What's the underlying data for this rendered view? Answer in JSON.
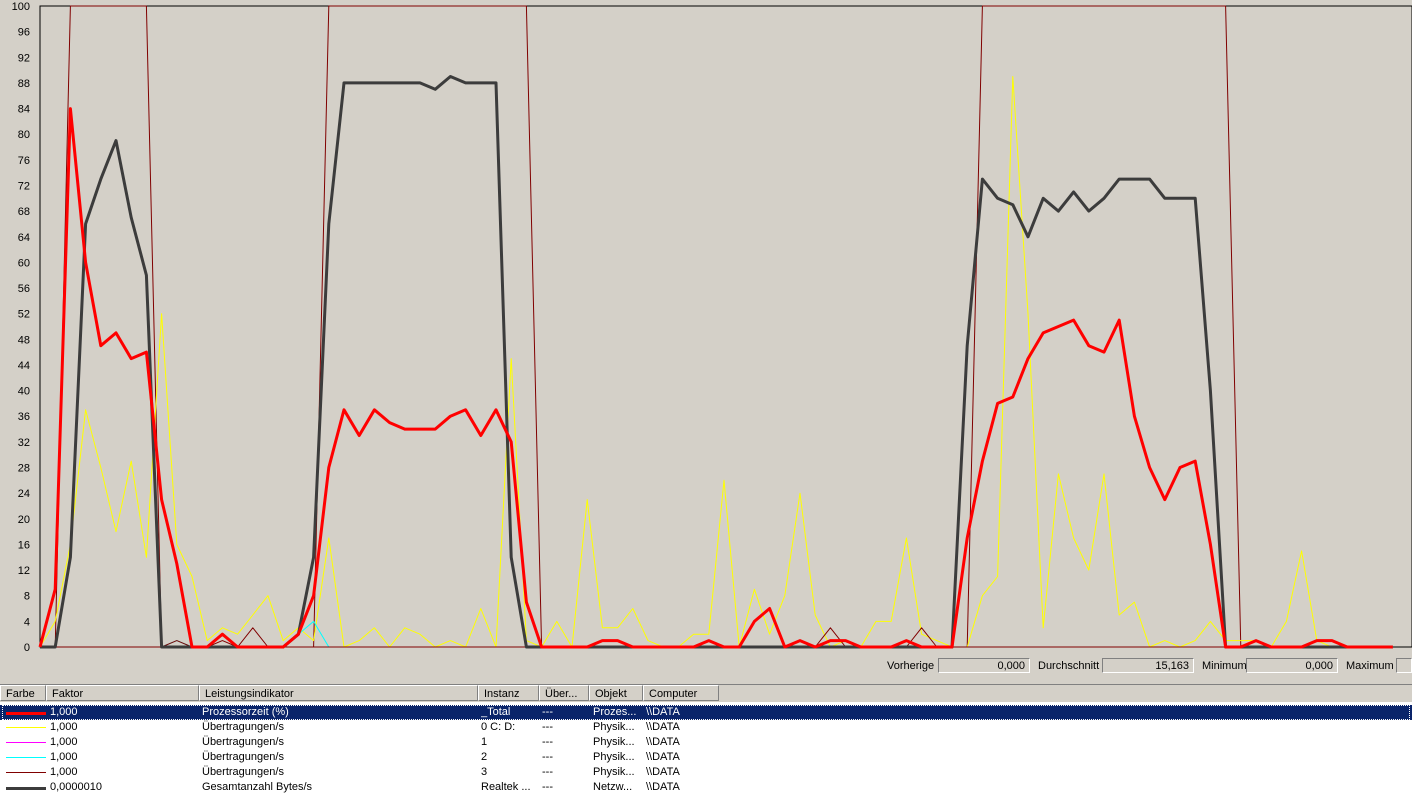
{
  "chart_data": {
    "type": "line",
    "ylim": [
      0,
      100
    ],
    "yticks": [
      0,
      4,
      8,
      12,
      16,
      20,
      24,
      28,
      32,
      36,
      40,
      44,
      48,
      52,
      56,
      60,
      64,
      68,
      72,
      76,
      80,
      84,
      88,
      92,
      96,
      100
    ],
    "grid": false,
    "x": [
      1,
      2,
      3,
      4,
      5,
      6,
      7,
      8,
      9,
      10,
      11,
      12,
      13,
      14,
      15,
      16,
      17,
      18,
      19,
      20,
      21,
      22,
      23,
      24,
      25,
      26,
      27,
      28,
      29,
      30,
      31,
      32,
      33,
      34,
      35,
      36,
      37,
      38,
      39,
      40,
      41,
      42,
      43,
      44,
      45,
      46,
      47,
      48,
      49,
      50,
      51,
      52,
      53,
      54,
      55,
      56,
      57,
      58,
      59,
      60,
      61,
      62,
      63,
      64,
      65,
      66,
      67,
      68,
      69,
      70,
      71,
      72,
      73,
      74,
      75,
      76,
      77,
      78,
      79,
      80,
      81,
      82,
      83,
      84,
      85,
      86,
      87,
      88,
      89,
      90
    ],
    "series": [
      {
        "name": "Prozessorzeit (%)",
        "color": "#ff0000",
        "width": 3,
        "values": [
          0,
          9,
          84,
          60,
          47,
          49,
          45,
          46,
          23,
          13,
          0,
          0,
          2,
          0,
          0,
          0,
          0,
          2,
          8,
          28,
          37,
          33,
          37,
          35,
          34,
          34,
          34,
          36,
          37,
          33,
          37,
          32,
          7,
          0,
          0,
          0,
          0,
          1,
          1,
          0,
          0,
          0,
          0,
          0,
          1,
          0,
          0,
          4,
          6,
          0,
          1,
          0,
          1,
          1,
          0,
          0,
          0,
          1,
          0,
          0,
          0,
          17,
          29,
          38,
          39,
          45,
          49,
          50,
          51,
          47,
          46,
          51,
          36,
          28,
          23,
          28,
          29,
          16,
          0,
          0,
          1,
          0,
          0,
          0,
          1,
          1,
          0,
          0,
          0,
          0
        ]
      },
      {
        "name": "Übertragungen/s 0 C: D:",
        "color": "#ffff00",
        "width": 1,
        "values": [
          0,
          4,
          16,
          37,
          28,
          18,
          29,
          14,
          52,
          16,
          11,
          1,
          3,
          2,
          5,
          8,
          1,
          3,
          1,
          17,
          0,
          1,
          3,
          0,
          3,
          2,
          0,
          1,
          0,
          6,
          0,
          45,
          1,
          0,
          4,
          0,
          23,
          3,
          3,
          6,
          1,
          0,
          0,
          2,
          2,
          26,
          0,
          9,
          2,
          8,
          24,
          5,
          0,
          1,
          0,
          4,
          4,
          17,
          2,
          1,
          0,
          0,
          8,
          11,
          89,
          52,
          3,
          27,
          17,
          12,
          27,
          5,
          7,
          0,
          1,
          0,
          1,
          4,
          1,
          1,
          1,
          0,
          4,
          15,
          1,
          0,
          0,
          0,
          0,
          0
        ]
      },
      {
        "name": "Übertragungen/s 1",
        "color": "#ff00ff",
        "width": 1,
        "values": [
          0,
          0,
          0,
          0,
          0,
          0,
          0,
          0,
          0,
          0,
          0,
          0,
          0,
          0,
          0,
          0,
          0,
          0,
          0,
          0,
          0,
          0,
          0,
          0,
          0,
          0,
          0,
          0,
          0,
          0,
          0,
          0,
          0,
          0,
          0,
          0,
          0,
          0,
          0,
          0,
          0,
          0,
          0,
          0,
          0,
          0,
          0,
          0,
          0,
          0,
          0,
          0,
          0,
          0,
          0,
          0,
          0,
          0,
          0,
          0,
          0,
          0,
          0,
          0,
          0,
          0,
          0,
          0,
          0,
          0,
          0,
          0,
          0,
          0,
          0,
          0,
          0,
          0,
          0,
          0,
          0,
          0,
          0,
          0,
          0,
          0,
          0,
          0,
          0,
          0
        ]
      },
      {
        "name": "Übertragungen/s 2",
        "color": "#00ffff",
        "width": 1,
        "values": [
          0,
          0,
          0,
          0,
          0,
          0,
          0,
          0,
          0,
          1,
          0,
          0,
          0,
          0,
          0,
          0,
          0,
          2,
          4,
          0,
          0,
          0,
          0,
          0,
          0,
          0,
          0,
          0,
          0,
          0,
          0,
          0,
          0,
          0,
          0,
          0,
          0,
          0,
          0,
          0,
          0,
          0,
          0,
          0,
          0,
          0,
          0,
          0,
          0,
          0,
          0,
          0,
          0,
          0,
          0,
          0,
          0,
          0,
          0,
          0,
          0,
          0,
          0,
          0,
          0,
          0,
          0,
          0,
          0,
          0,
          0,
          0,
          0,
          0,
          0,
          0,
          0,
          0,
          0,
          0,
          0,
          0,
          0,
          0,
          0,
          0,
          0,
          0,
          0,
          0
        ]
      },
      {
        "name": "Übertragungen/s 3",
        "color": "#800000",
        "width": 1,
        "values": [
          0,
          0,
          0,
          0,
          0,
          0,
          0,
          0,
          0,
          1,
          0,
          0,
          1,
          0,
          3,
          0,
          0,
          0,
          0,
          0,
          0,
          0,
          0,
          0,
          0,
          0,
          0,
          0,
          0,
          0,
          0,
          0,
          0,
          0,
          0,
          0,
          0,
          0,
          0,
          0,
          0,
          0,
          0,
          0,
          0,
          0,
          0,
          0,
          0,
          0,
          0,
          0,
          3,
          0,
          0,
          0,
          0,
          0,
          3,
          0,
          0,
          0,
          0,
          0,
          0,
          0,
          0,
          0,
          0,
          0,
          0,
          0,
          0,
          0,
          0,
          0,
          0,
          0,
          0,
          0,
          1,
          0,
          0,
          0,
          0,
          0,
          0,
          0,
          0,
          0
        ]
      },
      {
        "name": "Gesamtanzahl Bytes/s",
        "color": "#3c3c3c",
        "width": 3,
        "values": [
          0,
          0,
          14,
          66,
          73,
          79,
          67,
          58,
          0,
          0,
          0,
          0,
          0,
          0,
          0,
          0,
          0,
          2,
          14,
          66,
          88,
          88,
          88,
          88,
          88,
          88,
          87,
          89,
          88,
          88,
          88,
          14,
          0,
          0,
          0,
          0,
          0,
          0,
          0,
          0,
          0,
          0,
          0,
          0,
          0,
          0,
          0,
          0,
          0,
          0,
          0,
          0,
          0,
          0,
          0,
          0,
          0,
          0,
          0,
          0,
          0,
          47,
          73,
          70,
          69,
          64,
          70,
          68,
          71,
          68,
          70,
          73,
          73,
          73,
          70,
          70,
          70,
          40,
          0,
          0,
          0,
          0,
          0,
          0,
          0,
          0,
          0,
          0,
          0,
          0
        ]
      },
      {
        "name": "Prozessorzeit (%) Schwellwert",
        "color": "#800000",
        "width": 1,
        "values": [
          0,
          0,
          100,
          100,
          100,
          100,
          100,
          100,
          0,
          0,
          0,
          0,
          0,
          0,
          0,
          0,
          0,
          0,
          0,
          100,
          100,
          100,
          100,
          100,
          100,
          100,
          100,
          100,
          100,
          100,
          100,
          100,
          100,
          0,
          0,
          0,
          0,
          0,
          0,
          0,
          0,
          0,
          0,
          0,
          0,
          0,
          0,
          0,
          0,
          0,
          0,
          0,
          0,
          0,
          0,
          0,
          0,
          0,
          0,
          0,
          0,
          0,
          100,
          100,
          100,
          100,
          100,
          100,
          100,
          100,
          100,
          100,
          100,
          100,
          100,
          100,
          100,
          100,
          100,
          0,
          0,
          0,
          0,
          0,
          0,
          0,
          0,
          0,
          0,
          0
        ]
      }
    ]
  },
  "stats": {
    "vorherige_label": "Vorherige",
    "vorherige_value": "0,000",
    "durchschnitt_label": "Durchschnitt",
    "durchschnitt_value": "15,163",
    "minimum_label": "Minimum",
    "minimum_value": "0,000",
    "maximum_label": "Maximum"
  },
  "list": {
    "headers": [
      "Farbe",
      "Faktor",
      "Leistungsindikator",
      "Instanz",
      "Über...",
      "Objekt",
      "Computer"
    ],
    "rows": [
      {
        "color": "#ff0000",
        "thick": true,
        "faktor": "1,000",
        "indikator": "Prozessorzeit (%)",
        "instanz": "_Total",
        "ueber": "---",
        "objekt": "Prozes...",
        "computer": "\\\\DATA",
        "selected": true
      },
      {
        "color": "#ffff00",
        "thick": false,
        "faktor": "1,000",
        "indikator": "Übertragungen/s",
        "instanz": "0 C: D:",
        "ueber": "---",
        "objekt": "Physik...",
        "computer": "\\\\DATA"
      },
      {
        "color": "#ff00ff",
        "thick": false,
        "faktor": "1,000",
        "indikator": "Übertragungen/s",
        "instanz": "1",
        "ueber": "---",
        "objekt": "Physik...",
        "computer": "\\\\DATA"
      },
      {
        "color": "#00ffff",
        "thick": false,
        "faktor": "1,000",
        "indikator": "Übertragungen/s",
        "instanz": "2",
        "ueber": "---",
        "objekt": "Physik...",
        "computer": "\\\\DATA"
      },
      {
        "color": "#800000",
        "thick": false,
        "faktor": "1,000",
        "indikator": "Übertragungen/s",
        "instanz": "3",
        "ueber": "---",
        "objekt": "Physik...",
        "computer": "\\\\DATA"
      },
      {
        "color": "#3c3c3c",
        "thick": true,
        "faktor": "0,0000010",
        "indikator": "Gesamtanzahl Bytes/s",
        "instanz": "Realtek ...",
        "ueber": "---",
        "objekt": "Netzw...",
        "computer": "\\\\DATA"
      }
    ]
  }
}
